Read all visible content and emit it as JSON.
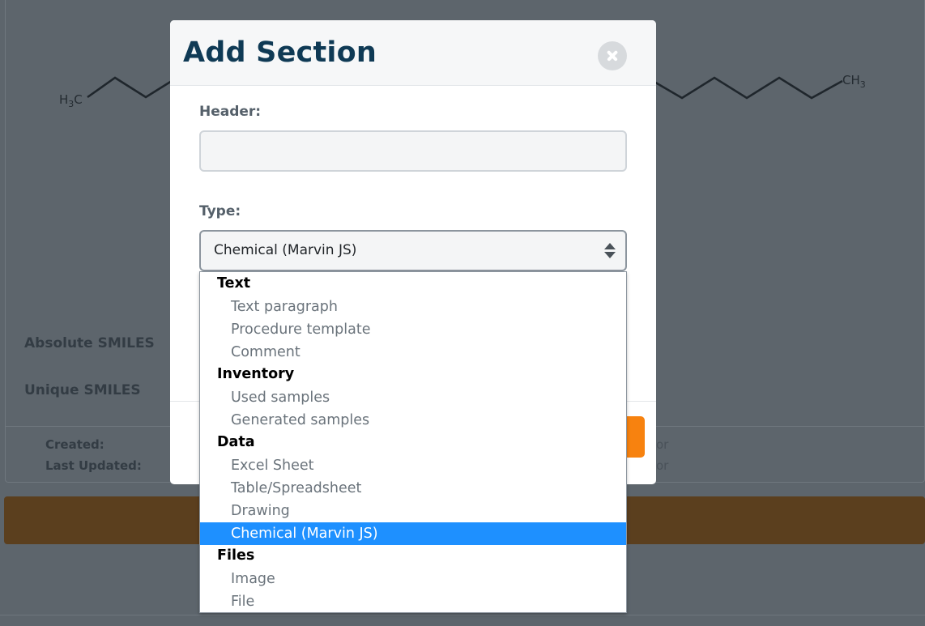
{
  "background": {
    "molecule": {
      "left_group_main": "H",
      "left_group_sub": "3",
      "left_group_end": "C",
      "right_group_main": "CH",
      "right_group_sub": "3"
    },
    "absolute_smiles_label": "Absolute SMILES",
    "unique_smiles_label": "Unique SMILES",
    "created_label": "Created:",
    "last_updated_label": "Last Updated:",
    "created_value_fragment": "or",
    "updated_value_fragment": "or"
  },
  "modal": {
    "title": "Add Section",
    "close_icon": "close-icon",
    "header_label": "Header:",
    "header_value": "",
    "type_label": "Type:",
    "type_selected": "Chemical (Marvin JS)"
  },
  "dropdown": {
    "groups": [
      {
        "label": "Text",
        "options": [
          "Text paragraph",
          "Procedure template",
          "Comment"
        ]
      },
      {
        "label": "Inventory",
        "options": [
          "Used samples",
          "Generated samples"
        ]
      },
      {
        "label": "Data",
        "options": [
          "Excel Sheet",
          "Table/Spreadsheet",
          "Drawing",
          "Chemical (Marvin JS)"
        ]
      },
      {
        "label": "Files",
        "options": [
          "Image",
          "File"
        ]
      }
    ],
    "selected_option": "Chemical (Marvin JS)"
  },
  "colors": {
    "title": "#0f3a55",
    "selected_highlight": "#1e90ff",
    "primary_button": "#f7820f",
    "overlay": "#5d656c"
  }
}
